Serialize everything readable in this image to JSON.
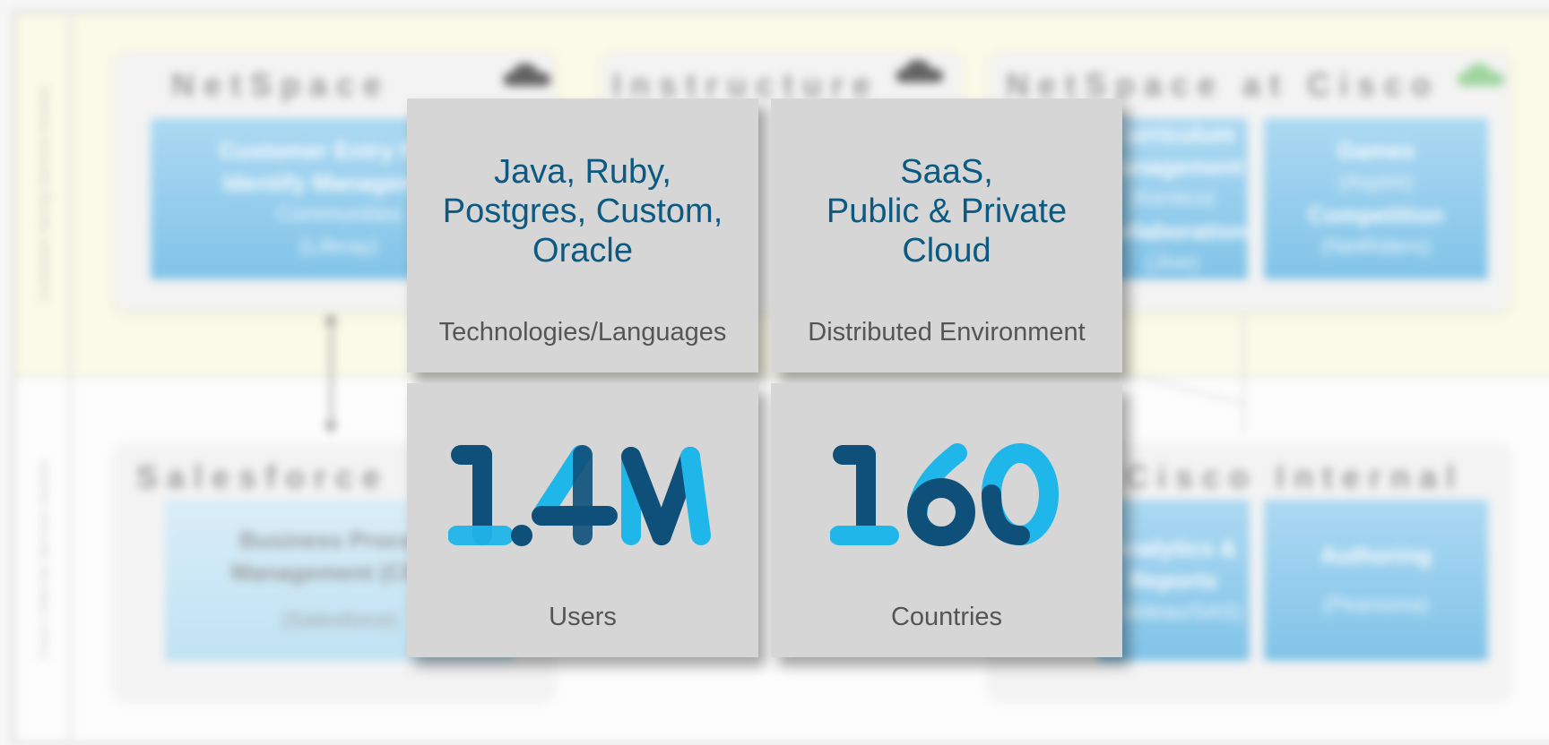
{
  "background": {
    "lanes": {
      "top_label": "Customer facing Service Assets",
      "bottom_label": "Cisco Internal Service Assets"
    },
    "panels": [
      {
        "title": "NetSpace",
        "cloud_color": "#4a4a4a",
        "boxes": [
          {
            "lines": [
              "Customer Entry Point",
              "Identify Management"
            ],
            "sub": [
              "Communities",
              "(Liferay)"
            ]
          }
        ]
      },
      {
        "title": "Instructure",
        "cloud_color": "#4a4a4a",
        "boxes": []
      },
      {
        "title": "NetSpace at Cisco",
        "cloud_color": "#8fd08f",
        "boxes": [
          {
            "lines": [
              "Curriculum",
              "Management"
            ],
            "sub": [
              "(Kentico)"
            ],
            "lines2": [
              "Collaboration"
            ],
            "sub2": [
              "(Jive)"
            ]
          },
          {
            "lines": [
              "Games"
            ],
            "sub": [
              "(Aspire)"
            ],
            "lines2": [
              "Competition"
            ],
            "sub2": [
              "(NetRiders)"
            ]
          }
        ]
      },
      {
        "title": "Salesforce",
        "boxes": [
          {
            "lines": [
              "Business Process",
              "Management (CRM)"
            ],
            "sub": [
              "(Salesforce)"
            ]
          }
        ]
      },
      {
        "title": "Cisco Internal",
        "boxes": [
          {
            "lines": [
              "Analytics &",
              "Reports"
            ],
            "sub": [
              "(Tableau/SAS)"
            ]
          },
          {
            "lines": [
              "Authoring"
            ],
            "sub": [
              "(Pearsona)"
            ]
          }
        ]
      }
    ]
  },
  "tiles": {
    "tech": {
      "main": "Java, Ruby,\nPostgres, Custom,\nOracle",
      "caption": "Technologies/Languages"
    },
    "env": {
      "main": "SaaS,\nPublic & Private\nCloud",
      "caption": "Distributed Environment"
    },
    "users": {
      "number": "1.4M",
      "caption": "Users"
    },
    "countries": {
      "number": "160",
      "caption": "Countries"
    }
  },
  "colors": {
    "dark_blue": "#0e5079",
    "light_blue": "#1fb6ea",
    "tile_bg": "#d6d6d6",
    "main_text": "#0c5a82",
    "caption_text": "#555555"
  }
}
